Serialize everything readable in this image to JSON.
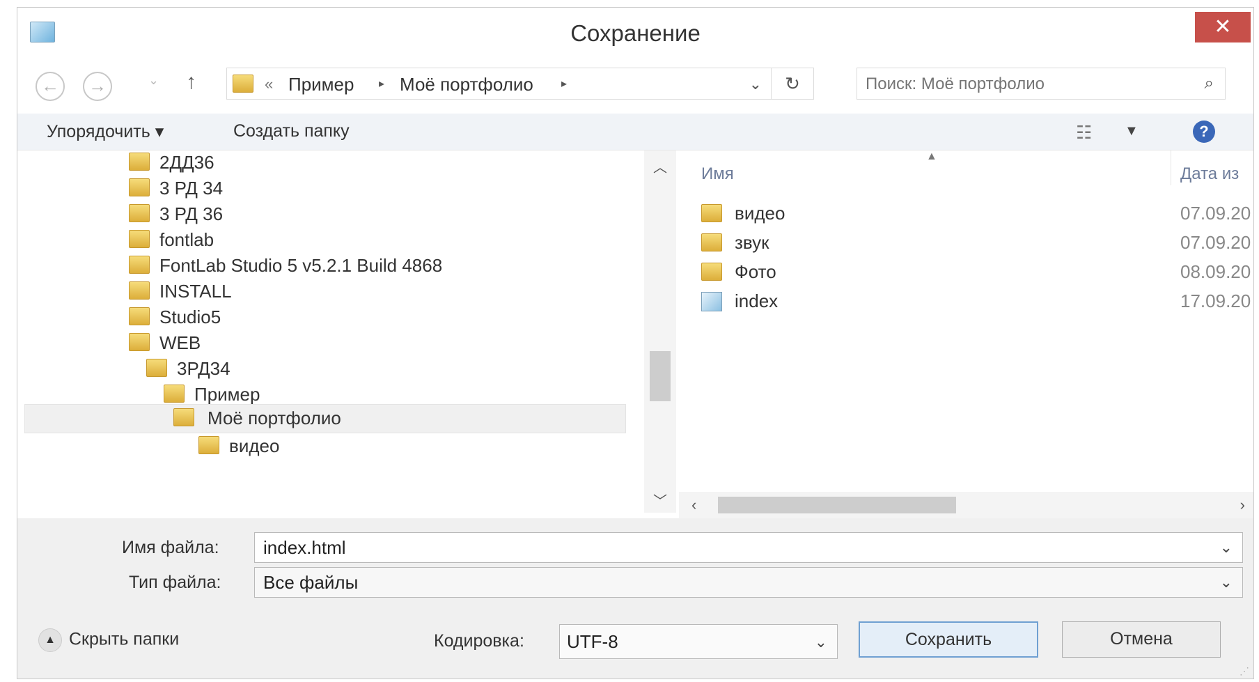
{
  "window": {
    "title": "Сохранение",
    "close_label": "✕"
  },
  "address": {
    "overflow": "«",
    "crumbs": [
      "Пример",
      "Моё портфолио"
    ],
    "search_placeholder": "Поиск: Моё портфолио"
  },
  "toolbar": {
    "organize_label": "Упорядочить ▾",
    "new_folder_label": "Создать папку",
    "help_label": "?"
  },
  "tree": {
    "items": [
      {
        "label": "2ДД36",
        "level": 0
      },
      {
        "label": "3 РД 34",
        "level": 0
      },
      {
        "label": "3 РД 36",
        "level": 0
      },
      {
        "label": "fontlab",
        "level": 0
      },
      {
        "label": "FontLab Studio 5 v5.2.1 Build 4868",
        "level": 0
      },
      {
        "label": "INSTALL",
        "level": 0
      },
      {
        "label": "Studio5",
        "level": 0
      },
      {
        "label": "WEB",
        "level": 0
      },
      {
        "label": "3РД34",
        "level": 1
      },
      {
        "label": "Пример",
        "level": 2
      },
      {
        "label": "Моё портфолио",
        "level": 3,
        "selected": true
      },
      {
        "label": "видео",
        "level": 4
      }
    ]
  },
  "files": {
    "columns": {
      "name": "Имя",
      "date": "Дата из"
    },
    "rows": [
      {
        "name": "видео",
        "date": "07.09.20",
        "type": "folder"
      },
      {
        "name": "звук",
        "date": "07.09.20",
        "type": "folder"
      },
      {
        "name": "Фото",
        "date": "08.09.20",
        "type": "folder"
      },
      {
        "name": "index",
        "date": "17.09.20",
        "type": "file"
      }
    ]
  },
  "form": {
    "filename_label": "Имя файла:",
    "filename_value": "index.html",
    "filetype_label": "Тип файла:",
    "filetype_value": "Все файлы",
    "hide_folders_label": "Скрыть папки",
    "encoding_label": "Кодировка:",
    "encoding_value": "UTF-8",
    "save_label": "Сохранить",
    "cancel_label": "Отмена"
  },
  "colors": {
    "close": "#c7504a",
    "toolbar_bg": "#f0f3f7",
    "bottom_bg": "#f0f0f0",
    "save_border": "#6fa0d2",
    "folder": "#e8c35a"
  }
}
